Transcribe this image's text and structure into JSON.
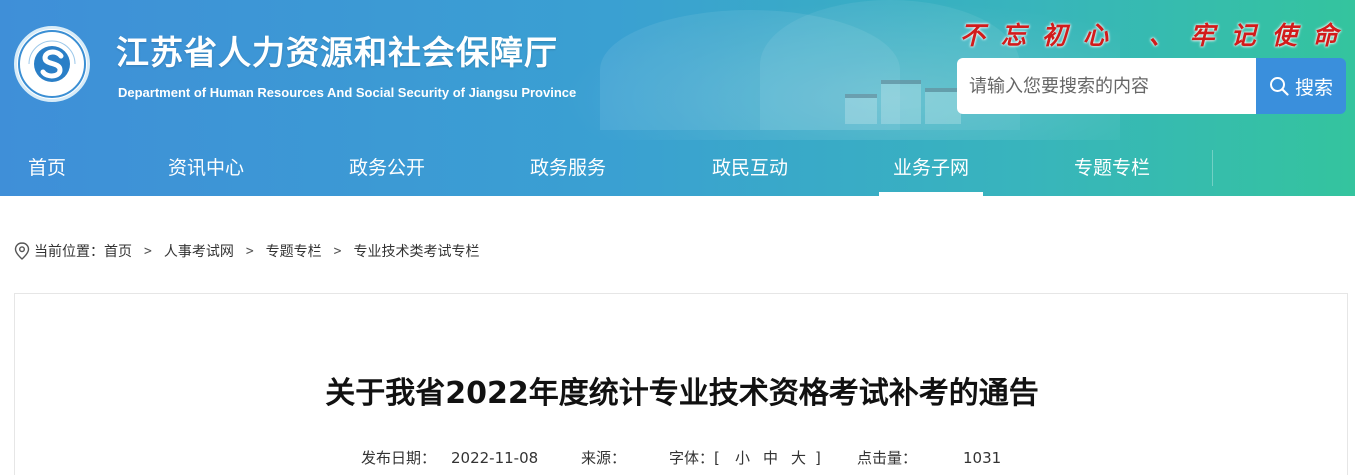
{
  "header": {
    "title_cn": "江苏省人力资源和社会保障厅",
    "title_en": "Department of Human Resources And Social Security of Jiangsu Province",
    "logo_text": "江苏省人力资源和社会保障厅",
    "slogan": "不忘初心 、牢记使命",
    "colors": {
      "gradient_start": "#3f8fd8",
      "gradient_end": "#34c49e",
      "slogan": "#d21b1b",
      "search_button": "#3a8fdc"
    }
  },
  "search": {
    "placeholder": "请输入您要搜索的内容",
    "value": "",
    "button_label": "搜索",
    "button_icon": "search-icon"
  },
  "nav": {
    "items": [
      {
        "label": "首页"
      },
      {
        "label": "资讯中心"
      },
      {
        "label": "政务公开"
      },
      {
        "label": "政务服务"
      },
      {
        "label": "政民互动"
      },
      {
        "label": "业务子网",
        "active": true
      },
      {
        "label": "专题专栏"
      }
    ]
  },
  "breadcrumb": {
    "icon": "location-pin-icon",
    "prefix": "当前位置：",
    "items": [
      "首页",
      "人事考试网",
      "专题专栏",
      "专业技术类考试专栏"
    ],
    "separator": ">"
  },
  "article": {
    "title": "关于我省2022年度统计专业技术资格考试补考的通告",
    "meta": {
      "date_label": "发布日期：",
      "date": "2022-11-08",
      "source_label": "来源：",
      "source": "",
      "font_label": "字体：[",
      "font_small": "小",
      "font_medium": "中",
      "font_large": "大",
      "font_close": "]",
      "clicks_label": "点击量：",
      "clicks": "1031"
    }
  }
}
